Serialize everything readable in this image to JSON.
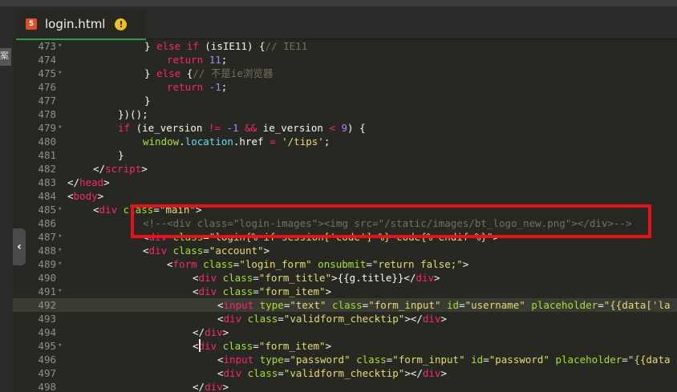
{
  "tab": {
    "filename": "login.html",
    "file_icon_glyph": "5",
    "warn_glyph": "!"
  },
  "sidebar": {
    "mark": "案",
    "toggle_glyph": "‹"
  },
  "lines": [
    {
      "n": "473",
      "fold": true
    },
    {
      "n": "474",
      "fold": false
    },
    {
      "n": "475",
      "fold": true
    },
    {
      "n": "476",
      "fold": false
    },
    {
      "n": "477",
      "fold": false
    },
    {
      "n": "478",
      "fold": false
    },
    {
      "n": "479",
      "fold": true
    },
    {
      "n": "480",
      "fold": false
    },
    {
      "n": "481",
      "fold": false
    },
    {
      "n": "482",
      "fold": false
    },
    {
      "n": "483",
      "fold": false
    },
    {
      "n": "484",
      "fold": false
    },
    {
      "n": "485",
      "fold": true
    },
    {
      "n": "486",
      "fold": false
    },
    {
      "n": "487",
      "fold": true
    },
    {
      "n": "488",
      "fold": true
    },
    {
      "n": "489",
      "fold": true
    },
    {
      "n": "490",
      "fold": false
    },
    {
      "n": "491",
      "fold": true
    },
    {
      "n": "492",
      "fold": false
    },
    {
      "n": "493",
      "fold": false
    },
    {
      "n": "494",
      "fold": false
    },
    {
      "n": "495",
      "fold": true
    },
    {
      "n": "496",
      "fold": false
    },
    {
      "n": "497",
      "fold": false
    },
    {
      "n": "498",
      "fold": false
    }
  ],
  "code": {
    "l473": {
      "a": "} ",
      "b": "else if",
      "c": " (isIE11) {",
      "d": "// IE11"
    },
    "l474": {
      "a": "return ",
      "b": "11",
      ";": ";"
    },
    "l475": {
      "a": "} ",
      "b": "else",
      "c": " {",
      "d": "// 不是ie浏览器"
    },
    "l476": {
      "a": "return ",
      "b": "-1",
      ";": ";"
    },
    "l477": {
      "a": "}"
    },
    "l478": {
      "a": "})();"
    },
    "l479": {
      "a": "if",
      " b": " (ie_version ",
      "c": "!=",
      "d": " -1 ",
      "e": "&&",
      "f": " ie_version ",
      "g": "<",
      "h": " 9",
      "i": ") {"
    },
    "l480": {
      "a": "window",
      "b": ".",
      "c": "location",
      "d": ".href ",
      "e": "=",
      "f": " '/tips'",
      ";": ";"
    },
    "l481": {
      "a": "}"
    },
    "l482": {
      "a": "</",
      "b": "script",
      "c": ">"
    },
    "l483": {
      "a": "</",
      "b": "head",
      "c": ">"
    },
    "l484": {
      "a": "<",
      "b": "body",
      "c": ">"
    },
    "l485": {
      "a": "<",
      "b": "div",
      "c": " class",
      "d": "=",
      "e": "\"main\"",
      "f": ">"
    },
    "l486": {
      "a": "<!--<div class=\"login-images\"><img src=\"/static/images/bt_logo_new.png\"></div>-->"
    },
    "l487": {
      "a": "<",
      "b": "div",
      "c": " class",
      "d": "=",
      "e": "\"login{% if session['code'] %} code{% endif %}\"",
      "f": ">"
    },
    "l488": {
      "a": "<",
      "b": "div",
      "c": " class",
      "d": "=",
      "e": "\"account\"",
      "f": ">"
    },
    "l489": {
      "a": "<",
      "b": "form",
      "c": " class",
      "d": "=",
      "e": "\"login_form\"",
      "f": " onsubmit",
      "g": "=",
      "h": "\"return false;\"",
      "i": ">"
    },
    "l490": {
      "a": "<",
      "b": "div",
      "c": " class",
      "d": "=",
      "e": "\"form_title\"",
      "f": ">{{g.title}}</",
      "g": "div",
      "h": ">"
    },
    "l491": {
      "a": "<",
      "b": "div",
      "c": " class",
      "d": "=",
      "e": "\"form_item\"",
      "f": ">"
    },
    "l492": {
      "a": "<",
      "b": "input",
      "c": " type",
      "d": "=",
      "e": "\"text\"",
      "f": " class",
      "g": "=",
      "h": "\"form_input\"",
      "i": " id",
      "j": "=",
      "k": "\"username\"",
      "l": " placeholder",
      "m": "=",
      "n": "\"{{data['la"
    },
    "l493": {
      "a": "<",
      "b": "div",
      "c": " class",
      "d": "=",
      "e": "\"validform_checktip\"",
      "f": "></",
      "g": "div",
      "h": ">"
    },
    "l494": {
      "a": "</",
      "b": "div",
      "c": ">"
    },
    "l495": {
      "a": "<",
      "b": "div",
      "c": " class",
      "d": "=",
      "e": "\"form_item\"",
      "f": ">"
    },
    "l496": {
      "a": "<",
      "b": "input",
      "c": " type",
      "d": "=",
      "e": "\"password\"",
      "f": " class",
      "g": "=",
      "h": "\"form_input\"",
      "i": " id",
      "j": "=",
      "k": "\"password\"",
      "l": " placeholder",
      "m": "=",
      "n": "\"{{data"
    },
    "l497": {
      "a": "<",
      "b": "div",
      "c": " class",
      "d": "=",
      "e": "\"validform_checktip\"",
      "f": "></",
      "g": "div",
      "h": ">"
    },
    "l498": {
      "a": "</",
      "b": "div",
      "c": ">"
    }
  },
  "colors": {
    "accent_tab": "#2e9a4a",
    "annotation_box": "#e8101a",
    "background": "#272822"
  }
}
